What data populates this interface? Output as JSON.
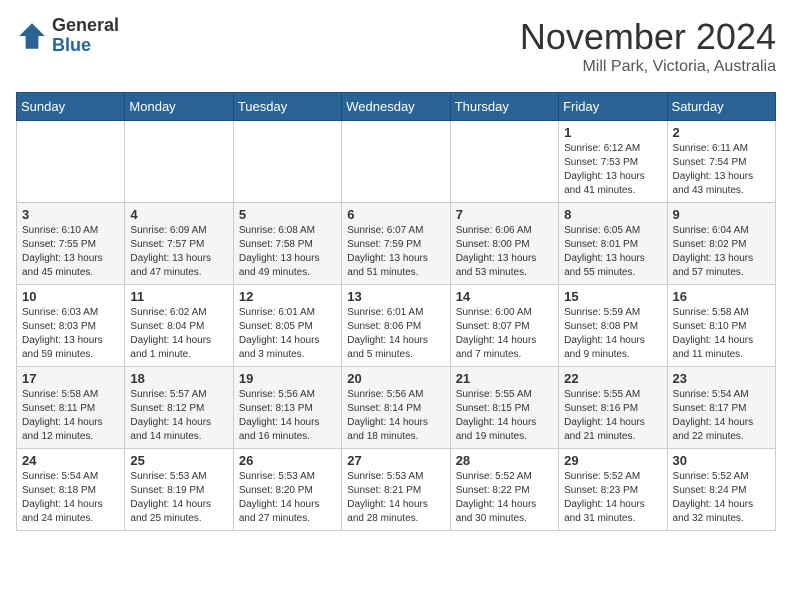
{
  "header": {
    "logo_general": "General",
    "logo_blue": "Blue",
    "month": "November 2024",
    "location": "Mill Park, Victoria, Australia"
  },
  "days_of_week": [
    "Sunday",
    "Monday",
    "Tuesday",
    "Wednesday",
    "Thursday",
    "Friday",
    "Saturday"
  ],
  "weeks": [
    [
      {
        "day": "",
        "info": ""
      },
      {
        "day": "",
        "info": ""
      },
      {
        "day": "",
        "info": ""
      },
      {
        "day": "",
        "info": ""
      },
      {
        "day": "",
        "info": ""
      },
      {
        "day": "1",
        "info": "Sunrise: 6:12 AM\nSunset: 7:53 PM\nDaylight: 13 hours\nand 41 minutes."
      },
      {
        "day": "2",
        "info": "Sunrise: 6:11 AM\nSunset: 7:54 PM\nDaylight: 13 hours\nand 43 minutes."
      }
    ],
    [
      {
        "day": "3",
        "info": "Sunrise: 6:10 AM\nSunset: 7:55 PM\nDaylight: 13 hours\nand 45 minutes."
      },
      {
        "day": "4",
        "info": "Sunrise: 6:09 AM\nSunset: 7:57 PM\nDaylight: 13 hours\nand 47 minutes."
      },
      {
        "day": "5",
        "info": "Sunrise: 6:08 AM\nSunset: 7:58 PM\nDaylight: 13 hours\nand 49 minutes."
      },
      {
        "day": "6",
        "info": "Sunrise: 6:07 AM\nSunset: 7:59 PM\nDaylight: 13 hours\nand 51 minutes."
      },
      {
        "day": "7",
        "info": "Sunrise: 6:06 AM\nSunset: 8:00 PM\nDaylight: 13 hours\nand 53 minutes."
      },
      {
        "day": "8",
        "info": "Sunrise: 6:05 AM\nSunset: 8:01 PM\nDaylight: 13 hours\nand 55 minutes."
      },
      {
        "day": "9",
        "info": "Sunrise: 6:04 AM\nSunset: 8:02 PM\nDaylight: 13 hours\nand 57 minutes."
      }
    ],
    [
      {
        "day": "10",
        "info": "Sunrise: 6:03 AM\nSunset: 8:03 PM\nDaylight: 13 hours\nand 59 minutes."
      },
      {
        "day": "11",
        "info": "Sunrise: 6:02 AM\nSunset: 8:04 PM\nDaylight: 14 hours\nand 1 minute."
      },
      {
        "day": "12",
        "info": "Sunrise: 6:01 AM\nSunset: 8:05 PM\nDaylight: 14 hours\nand 3 minutes."
      },
      {
        "day": "13",
        "info": "Sunrise: 6:01 AM\nSunset: 8:06 PM\nDaylight: 14 hours\nand 5 minutes."
      },
      {
        "day": "14",
        "info": "Sunrise: 6:00 AM\nSunset: 8:07 PM\nDaylight: 14 hours\nand 7 minutes."
      },
      {
        "day": "15",
        "info": "Sunrise: 5:59 AM\nSunset: 8:08 PM\nDaylight: 14 hours\nand 9 minutes."
      },
      {
        "day": "16",
        "info": "Sunrise: 5:58 AM\nSunset: 8:10 PM\nDaylight: 14 hours\nand 11 minutes."
      }
    ],
    [
      {
        "day": "17",
        "info": "Sunrise: 5:58 AM\nSunset: 8:11 PM\nDaylight: 14 hours\nand 12 minutes."
      },
      {
        "day": "18",
        "info": "Sunrise: 5:57 AM\nSunset: 8:12 PM\nDaylight: 14 hours\nand 14 minutes."
      },
      {
        "day": "19",
        "info": "Sunrise: 5:56 AM\nSunset: 8:13 PM\nDaylight: 14 hours\nand 16 minutes."
      },
      {
        "day": "20",
        "info": "Sunrise: 5:56 AM\nSunset: 8:14 PM\nDaylight: 14 hours\nand 18 minutes."
      },
      {
        "day": "21",
        "info": "Sunrise: 5:55 AM\nSunset: 8:15 PM\nDaylight: 14 hours\nand 19 minutes."
      },
      {
        "day": "22",
        "info": "Sunrise: 5:55 AM\nSunset: 8:16 PM\nDaylight: 14 hours\nand 21 minutes."
      },
      {
        "day": "23",
        "info": "Sunrise: 5:54 AM\nSunset: 8:17 PM\nDaylight: 14 hours\nand 22 minutes."
      }
    ],
    [
      {
        "day": "24",
        "info": "Sunrise: 5:54 AM\nSunset: 8:18 PM\nDaylight: 14 hours\nand 24 minutes."
      },
      {
        "day": "25",
        "info": "Sunrise: 5:53 AM\nSunset: 8:19 PM\nDaylight: 14 hours\nand 25 minutes."
      },
      {
        "day": "26",
        "info": "Sunrise: 5:53 AM\nSunset: 8:20 PM\nDaylight: 14 hours\nand 27 minutes."
      },
      {
        "day": "27",
        "info": "Sunrise: 5:53 AM\nSunset: 8:21 PM\nDaylight: 14 hours\nand 28 minutes."
      },
      {
        "day": "28",
        "info": "Sunrise: 5:52 AM\nSunset: 8:22 PM\nDaylight: 14 hours\nand 30 minutes."
      },
      {
        "day": "29",
        "info": "Sunrise: 5:52 AM\nSunset: 8:23 PM\nDaylight: 14 hours\nand 31 minutes."
      },
      {
        "day": "30",
        "info": "Sunrise: 5:52 AM\nSunset: 8:24 PM\nDaylight: 14 hours\nand 32 minutes."
      }
    ]
  ]
}
